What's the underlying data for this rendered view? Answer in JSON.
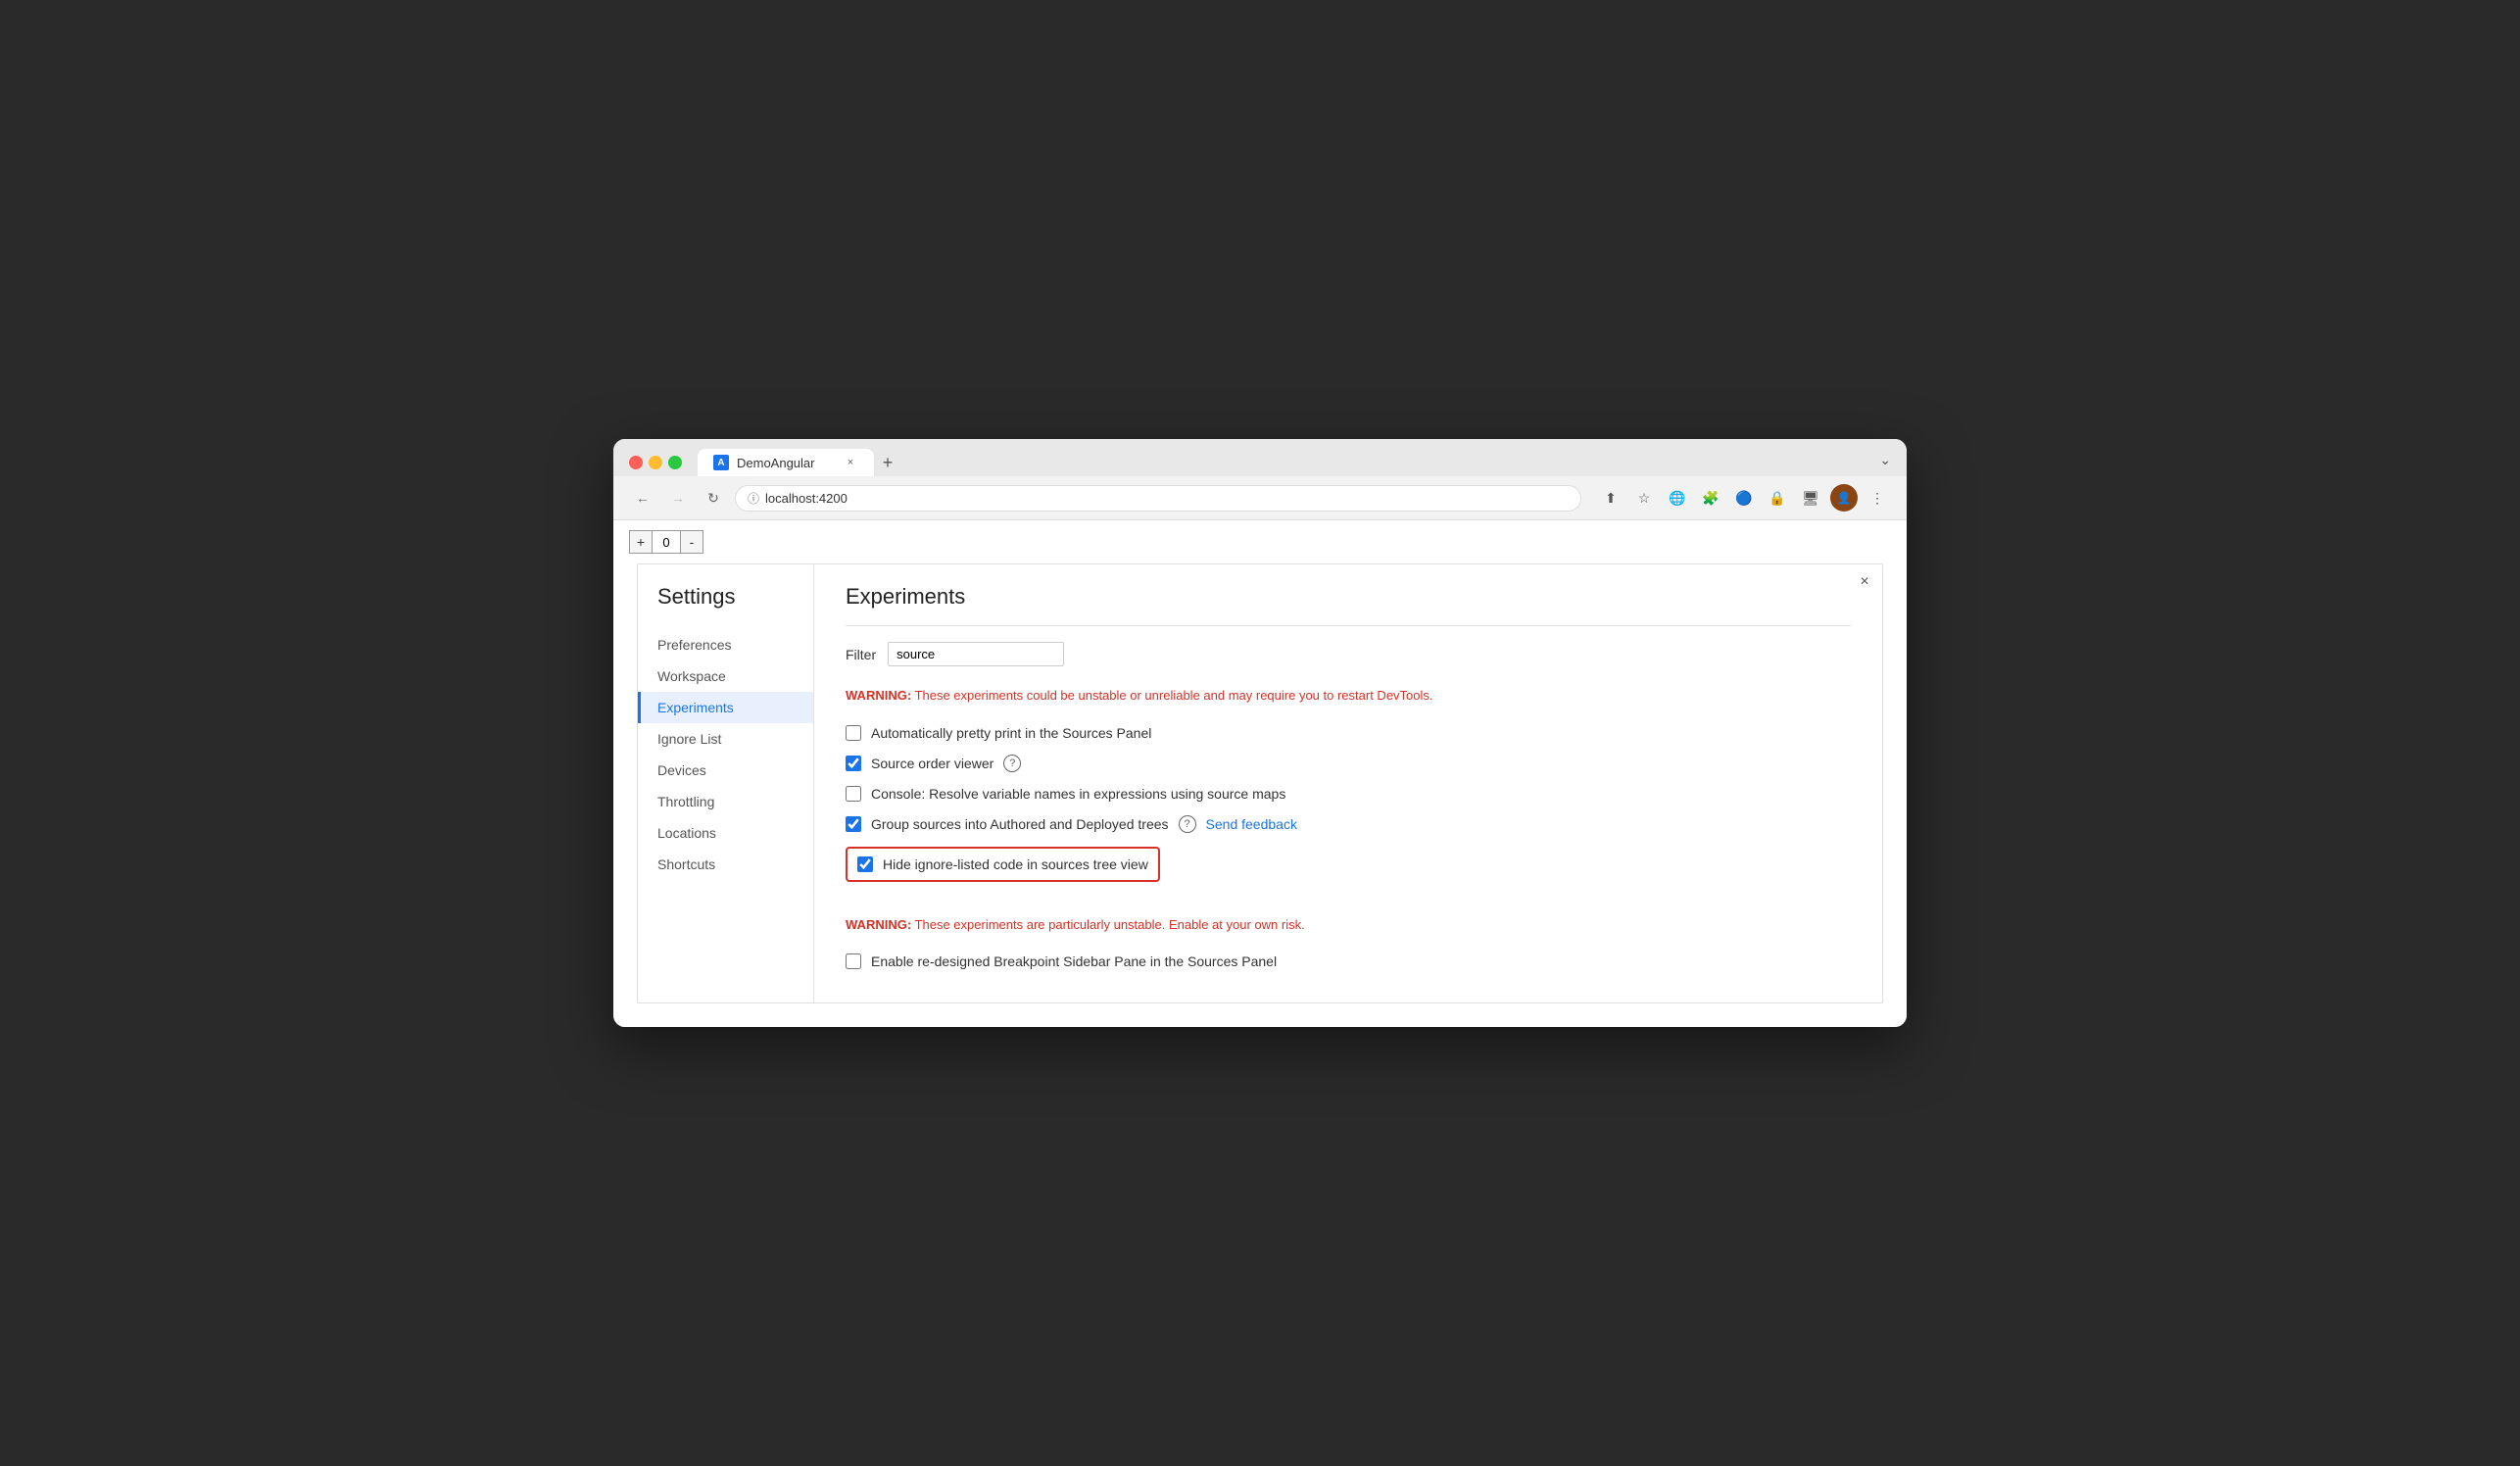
{
  "browser": {
    "tab_title": "DemoAngular",
    "tab_close": "×",
    "tab_new": "+",
    "url": "localhost:4200",
    "dropdown_arrow": "⌄",
    "nav": {
      "back": "←",
      "forward": "→",
      "reload": "↻"
    }
  },
  "counter": {
    "plus": "+",
    "value": "0",
    "minus": "-"
  },
  "devtools": {
    "close": "×"
  },
  "settings": {
    "title": "Settings",
    "nav_items": [
      {
        "id": "preferences",
        "label": "Preferences",
        "active": false
      },
      {
        "id": "workspace",
        "label": "Workspace",
        "active": false
      },
      {
        "id": "experiments",
        "label": "Experiments",
        "active": true
      },
      {
        "id": "ignore-list",
        "label": "Ignore List",
        "active": false
      },
      {
        "id": "devices",
        "label": "Devices",
        "active": false
      },
      {
        "id": "throttling",
        "label": "Throttling",
        "active": false
      },
      {
        "id": "locations",
        "label": "Locations",
        "active": false
      },
      {
        "id": "shortcuts",
        "label": "Shortcuts",
        "active": false
      }
    ]
  },
  "experiments": {
    "page_title": "Experiments",
    "filter_label": "Filter",
    "filter_value": "source",
    "filter_placeholder": "Filter",
    "warning_general": "These experiments could be unstable or unreliable and may require you to restart DevTools.",
    "warning_label": "WARNING:",
    "warning_unstable": "These experiments are particularly unstable. Enable at your own risk.",
    "items": [
      {
        "id": "pretty-print",
        "label": "Automatically pretty print in the Sources Panel",
        "checked": false,
        "has_help": false,
        "has_feedback": false,
        "highlighted": false
      },
      {
        "id": "source-order",
        "label": "Source order viewer",
        "checked": true,
        "has_help": true,
        "has_feedback": false,
        "highlighted": false
      },
      {
        "id": "resolve-variable",
        "label": "Console: Resolve variable names in expressions using source maps",
        "checked": false,
        "has_help": false,
        "has_feedback": false,
        "highlighted": false
      },
      {
        "id": "group-sources",
        "label": "Group sources into Authored and Deployed trees",
        "checked": true,
        "has_help": true,
        "has_feedback": true,
        "highlighted": false
      },
      {
        "id": "hide-ignore",
        "label": "Hide ignore-listed code in sources tree view",
        "checked": true,
        "has_help": false,
        "has_feedback": false,
        "highlighted": true
      }
    ],
    "unstable_items": [
      {
        "id": "breakpoint-sidebar",
        "label": "Enable re-designed Breakpoint Sidebar Pane in the Sources Panel",
        "checked": false,
        "has_help": false,
        "has_feedback": false,
        "highlighted": false
      }
    ],
    "help_icon": "?",
    "send_feedback_label": "Send feedback"
  }
}
